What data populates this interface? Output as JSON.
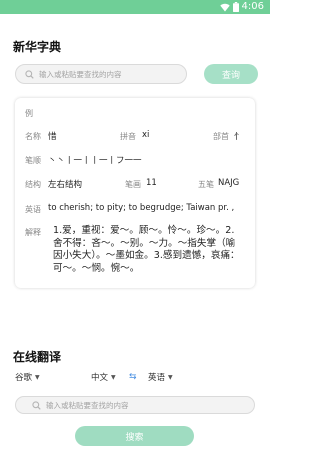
{
  "statusbar": {
    "time": "4:06",
    "color": "#6fcf97",
    "icons": [
      "wifi-icon",
      "battery-icon"
    ]
  },
  "dictionary": {
    "title": "新华字典",
    "search_placeholder": "输入或粘贴要查找的内容",
    "query_button": "查询",
    "result": {
      "example_label": "例",
      "name_label": "名称",
      "name_value": "惜",
      "pinyin_label": "拼音",
      "pinyin_value": "xi",
      "radical_label": "部首",
      "radical_value": "忄",
      "strokes_order_label": "笔顺",
      "strokes_order_value": "丶丶丨一丨丨一丨フ一一",
      "structure_label": "结构",
      "structure_value": "左右结构",
      "stroke_count_label": "笔画",
      "stroke_count_value": "11",
      "wubi_label": "五笔",
      "wubi_value": "NAJG",
      "english_label": "英语",
      "english_value": "to cherish; to pity; to begrudge; Taiwan pr. ,",
      "explain_label": "解释",
      "explain_value": "1.爱，重视：爱～。顾～。怜～。珍～。2.舍不得：吝～。～别。～力。～指失掌（喻因小失大）。～墨如金。3.感到遗憾，哀痛：可～。～悯。惋～。"
    }
  },
  "translate": {
    "title": "在线翻译",
    "engine": "谷歌",
    "source_lang": "中文",
    "target_lang": "英语",
    "swap_symbol": "⇆",
    "search_placeholder": "输入或粘贴要查找的内容",
    "search_button": "搜索"
  }
}
